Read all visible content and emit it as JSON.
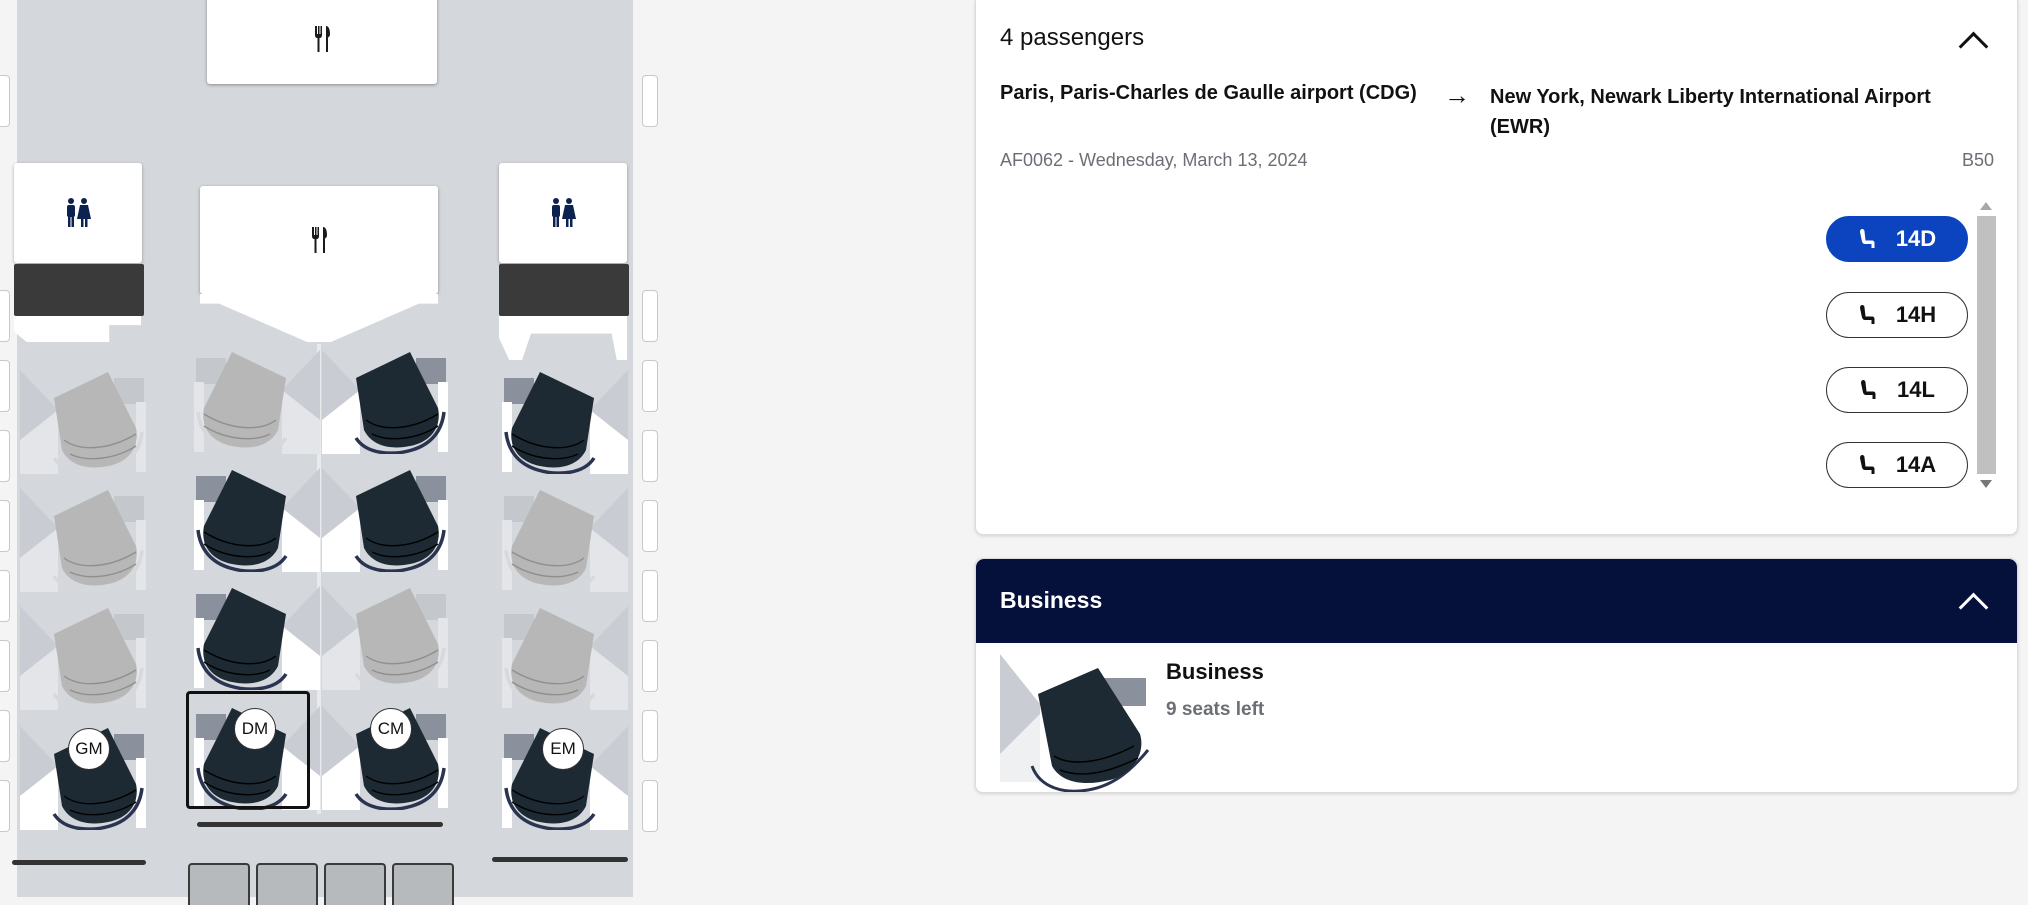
{
  "seat_map": {
    "occupant_tags": {
      "gm": "GM",
      "dm": "DM",
      "cm": "CM",
      "em": "EM"
    }
  },
  "passenger_panel": {
    "title": "4 passengers",
    "route": {
      "from": "Paris, Paris-Charles de Gaulle airport (CDG)",
      "arrow": "→",
      "to": "New York, Newark Liberty International Airport (EWR)"
    },
    "flight_info": "AF0062 - Wednesday, March 13, 2024",
    "aircraft": "B50",
    "seats": [
      {
        "label": "14D",
        "active": true
      },
      {
        "label": "14H",
        "active": false
      },
      {
        "label": "14L",
        "active": false
      },
      {
        "label": "14A",
        "active": false
      }
    ]
  },
  "cabin_panel": {
    "header": "Business",
    "cabin_name": "Business",
    "seats_left": "9 seats left"
  },
  "colors": {
    "fuselage": "#d4d7db",
    "seat_available": "#1d2a33",
    "seat_unavailable": "#b7b7b7",
    "accent_blue": "#0c44c0",
    "navy": "#05113a"
  },
  "icons": {
    "galley": "fork-knife-icon",
    "lavatory": "restroom-icon",
    "seat_chip": "seat-icon",
    "collapse": "chevron-up-icon"
  }
}
